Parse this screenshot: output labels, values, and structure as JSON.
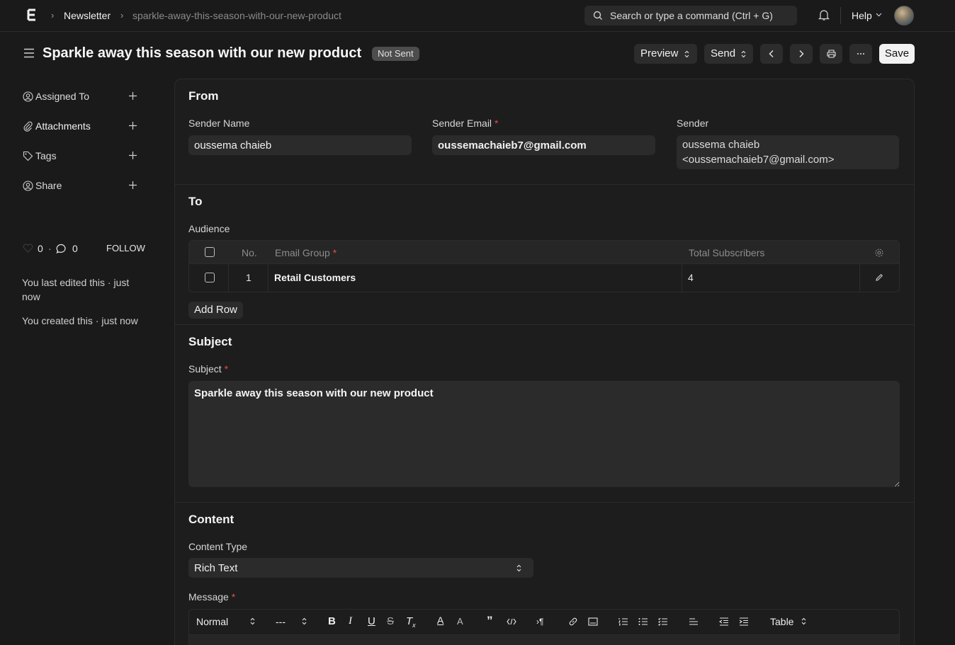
{
  "navbar": {
    "breadcrumb": [
      "Newsletter",
      "sparkle-away-this-season-with-our-new-product"
    ],
    "search_text": "Search or type a command (Ctrl + G)",
    "help_label": "Help"
  },
  "header": {
    "title": "Sparkle away this season with our new product",
    "status": "Not Sent",
    "preview_label": "Preview",
    "send_label": "Send",
    "save_label": "Save"
  },
  "sidebar": {
    "items": [
      {
        "label": "Assigned To",
        "icon": "assign-icon"
      },
      {
        "label": "Attachments",
        "icon": "paperclip-icon"
      },
      {
        "label": "Tags",
        "icon": "tag-icon"
      },
      {
        "label": "Share",
        "icon": "share-icon"
      }
    ],
    "likes": "0",
    "comments": "0",
    "follow_label": "FOLLOW",
    "activity": [
      "You last edited this · just now",
      "You created this · just now"
    ]
  },
  "from": {
    "heading": "From",
    "sender_name_label": "Sender Name",
    "sender_name": "oussema chaieb",
    "sender_email_label": "Sender Email",
    "sender_email": "oussemachaieb7@gmail.com",
    "sender_label": "Sender",
    "sender_line1": "oussema chaieb",
    "sender_line2": "<oussemachaieb7@gmail.com>"
  },
  "to": {
    "heading": "To",
    "audience_label": "Audience",
    "columns": [
      "No.",
      "Email Group",
      "Total Subscribers"
    ],
    "rows": [
      {
        "no": "1",
        "group": "Retail Customers",
        "total": "4"
      }
    ],
    "add_row_label": "Add Row"
  },
  "subject": {
    "heading": "Subject",
    "label": "Subject",
    "value": "Sparkle away this season with our new product"
  },
  "content": {
    "heading": "Content",
    "type_label": "Content Type",
    "type_value": "Rich Text",
    "message_label": "Message",
    "toolbar": {
      "style": "Normal",
      "size": "---",
      "table": "Table"
    }
  },
  "colors": {
    "background": "#1a1a1a",
    "required": "#e24c4c",
    "save_button": "#f2f2f2"
  }
}
